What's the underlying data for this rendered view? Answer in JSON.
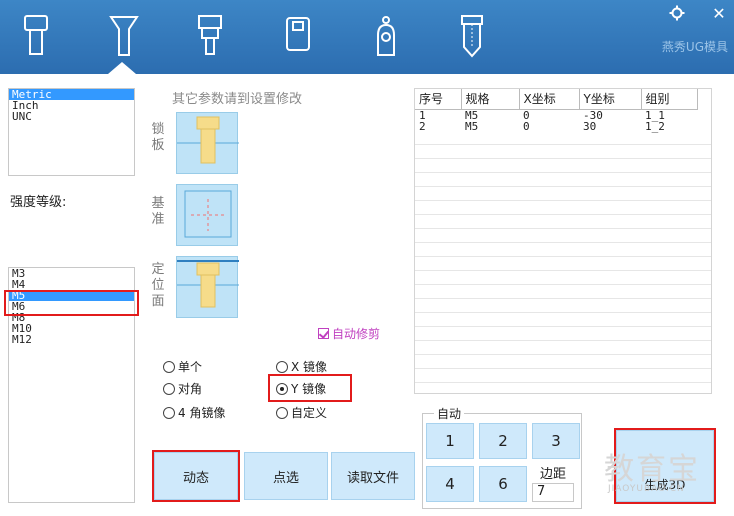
{
  "toolbar": {
    "tools": [
      {
        "name": "tool-socket-screw",
        "icon": "socket-screw-icon"
      },
      {
        "name": "tool-countersunk-screw",
        "icon": "countersunk-screw-icon"
      },
      {
        "name": "tool-shoulder-screw",
        "icon": "shoulder-screw-icon"
      },
      {
        "name": "tool-plate",
        "icon": "plate-icon"
      },
      {
        "name": "tool-eyebolt",
        "icon": "eyebolt-icon"
      },
      {
        "name": "tool-pin",
        "icon": "pin-icon"
      }
    ],
    "brand": "燕秀UG模具"
  },
  "units": {
    "options": [
      "Metric",
      "Inch",
      "UNC"
    ],
    "selected": "Metric"
  },
  "strength_label": "强度等级:",
  "hint": "其它参数请到设置修改",
  "preview_labels": {
    "lock_plate": "锁板",
    "datum": "基准",
    "locating_face": "定位面"
  },
  "sizes": {
    "options": [
      "M3",
      "M4",
      "M5",
      "M6",
      "M8",
      "M10",
      "M12"
    ],
    "selected": "M5"
  },
  "auto_trim": "自动修剪",
  "radios": {
    "single": "单个",
    "x_mirror": "X 镜像",
    "diagonal": "对角",
    "y_mirror": "Y 镜像",
    "four_corner": "4 角镜像",
    "custom": "自定义",
    "selected": "y_mirror"
  },
  "buttons": {
    "dynamic": "动态",
    "pick": "点选",
    "read_file": "读取文件",
    "generate": "生成3D"
  },
  "table": {
    "headers": [
      "序号",
      "规格",
      "X坐标",
      "Y坐标",
      "组别"
    ],
    "rows": [
      [
        "1",
        "M5",
        "0",
        "-30",
        "1_1"
      ],
      [
        "2",
        "M5",
        "0",
        "30",
        "1_2"
      ]
    ]
  },
  "auto_group": {
    "title": "自动",
    "keys": [
      "1",
      "2",
      "3",
      "4",
      "6"
    ],
    "margin_label": "边距",
    "margin_value": "7"
  },
  "watermark": {
    "main": "教育宝",
    "sub": "JIAOYUBAO.CN"
  },
  "window": {
    "settings_icon": "gear-icon",
    "close_glyph": "✕"
  }
}
